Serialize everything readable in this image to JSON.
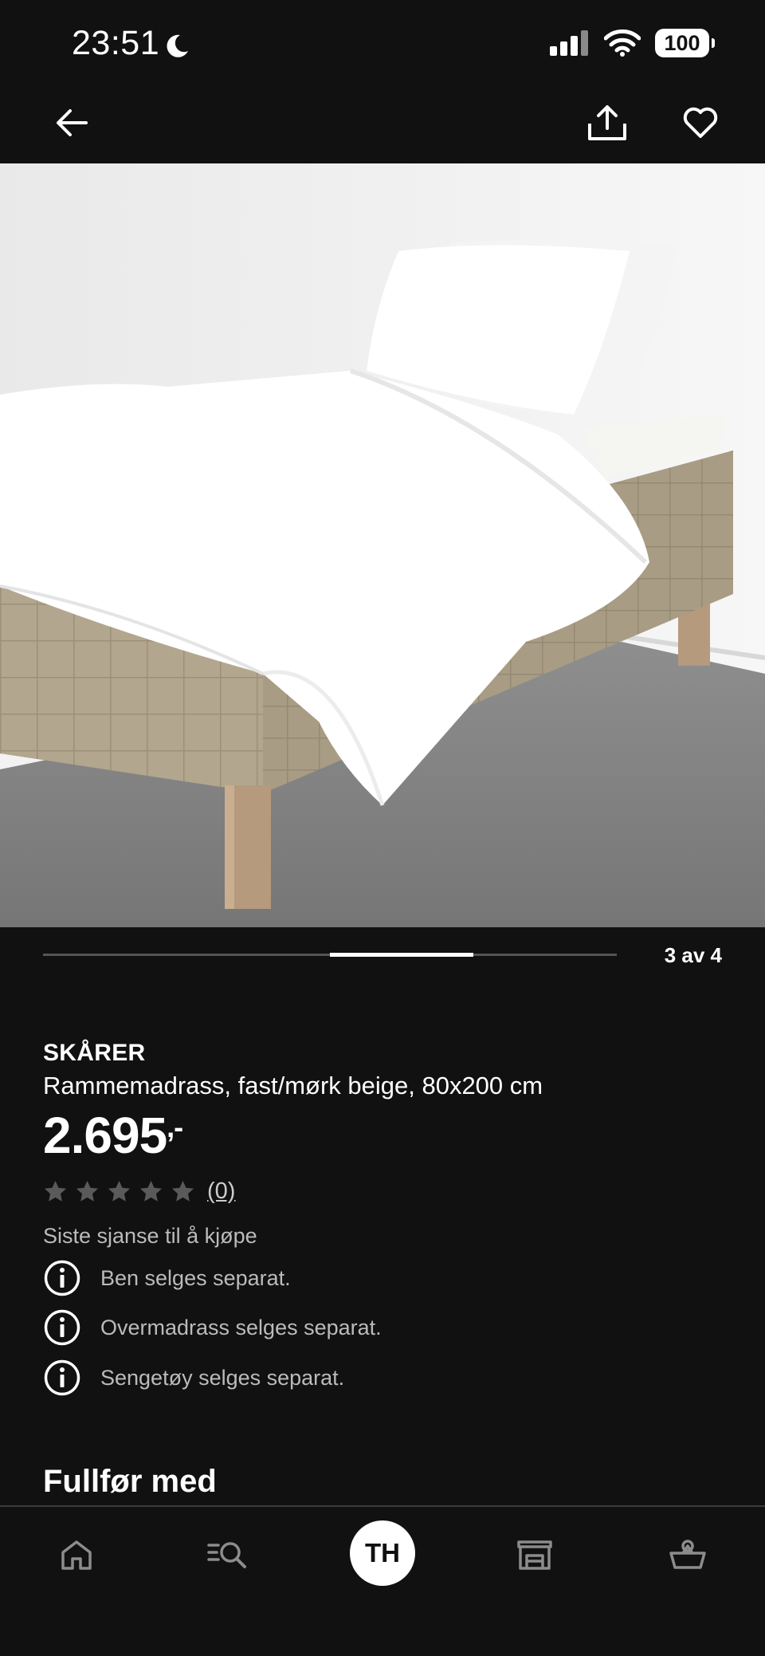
{
  "status_bar": {
    "time": "23:51",
    "battery": "100",
    "icons": [
      "moon-icon",
      "signal-icon",
      "wifi-icon",
      "battery-icon"
    ]
  },
  "top_nav": {
    "icons": [
      "arrow-left-icon",
      "share-icon",
      "heart-icon"
    ]
  },
  "carousel": {
    "counter": "3 av 4",
    "current": 3,
    "total": 4
  },
  "product": {
    "brand": "SKÅRER",
    "description": "Rammemadrass, fast/mørk beige, 80x200 cm",
    "price": "2.695",
    "price_suffix": ",-",
    "rating": 0,
    "rating_max": 5,
    "rating_count": "(0)",
    "availability": "Siste sjanse til å kjøpe",
    "notes": [
      "Ben selges separat.",
      "Overmadrass selges separat.",
      "Sengetøy selges separat."
    ]
  },
  "section": {
    "title": "Fullfør med"
  },
  "tab_bar": {
    "avatar_initials": "TH",
    "icons": [
      "home-icon",
      "search-icon",
      "store-icon",
      "basket-icon"
    ]
  },
  "colors": {
    "background": "#111111",
    "text": "#ffffff",
    "muted_text": "#bbbbbb",
    "star_empty": "#5a5a5a",
    "bed_fabric": "#b2a68e"
  }
}
